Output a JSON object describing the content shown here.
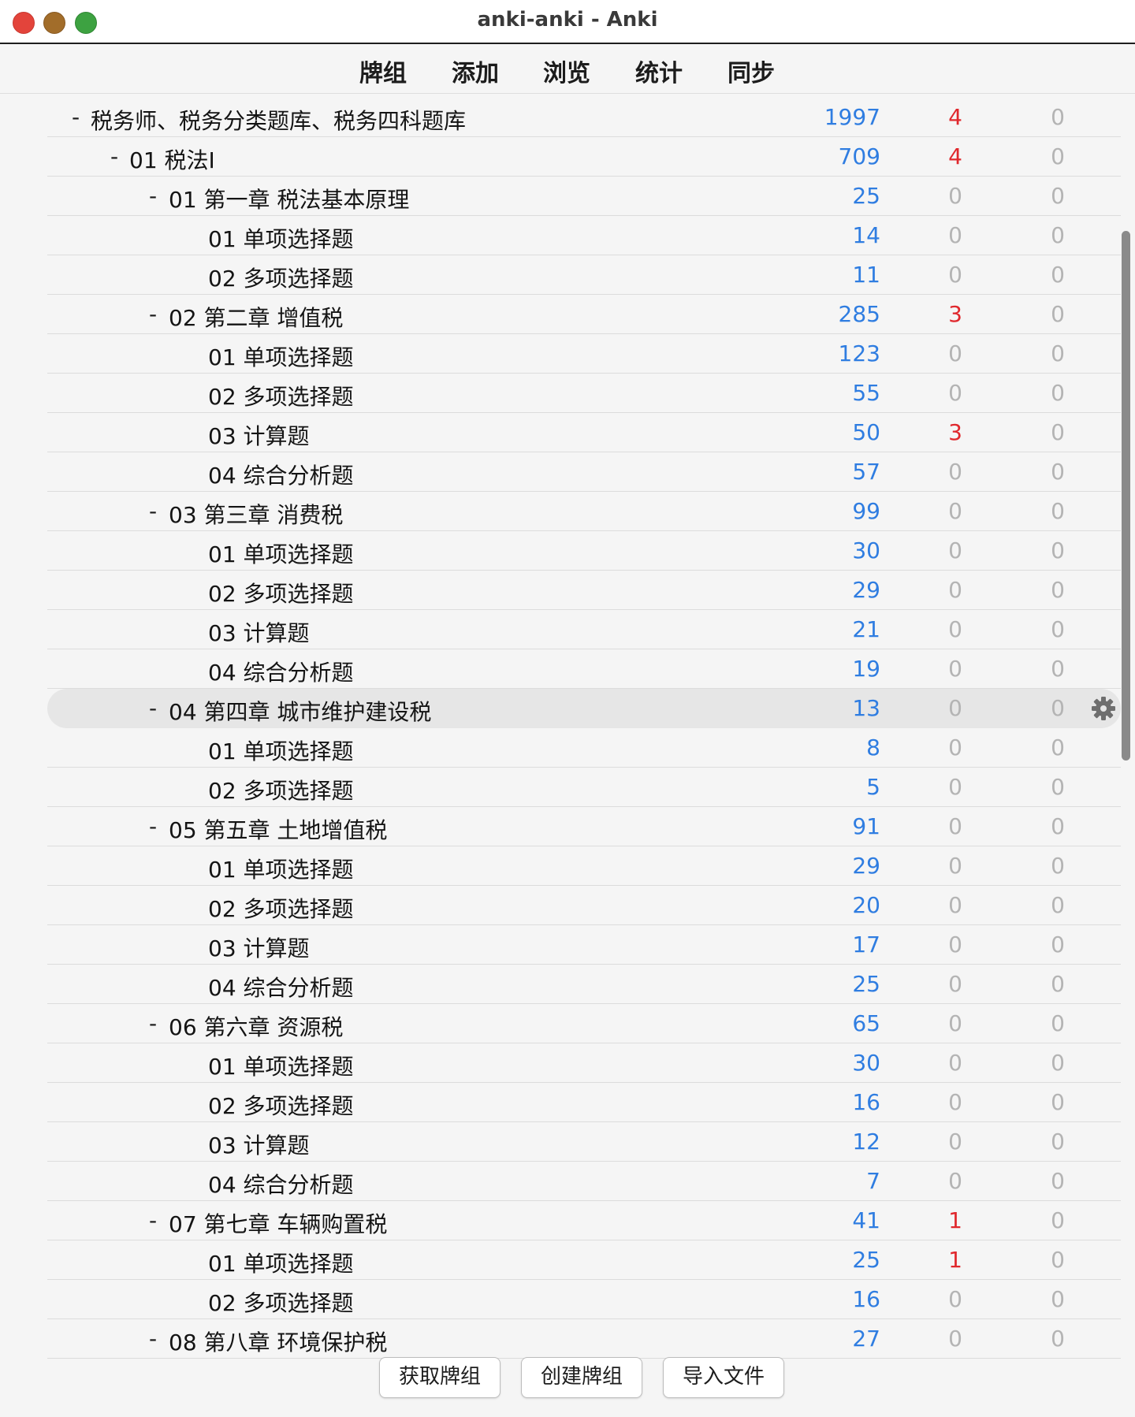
{
  "window": {
    "title": "anki-anki - Anki"
  },
  "toolbar": {
    "items": [
      {
        "label": "牌组"
      },
      {
        "label": "添加"
      },
      {
        "label": "浏览"
      },
      {
        "label": "统计"
      },
      {
        "label": "同步"
      }
    ]
  },
  "decks": [
    {
      "collapse": "-",
      "name": "税务师、税务分类题库、税务四科题库",
      "level": 0,
      "due": "1997",
      "new": "4",
      "learn": "0"
    },
    {
      "collapse": "-",
      "name": "01 税法I",
      "level": 1,
      "due": "709",
      "new": "4",
      "learn": "0"
    },
    {
      "collapse": "-",
      "name": "01 第一章 税法基本原理",
      "level": 2,
      "due": "25",
      "new": "0",
      "learn": "0"
    },
    {
      "collapse": "",
      "name": "01 单项选择题",
      "level": 3,
      "due": "14",
      "new": "0",
      "learn": "0"
    },
    {
      "collapse": "",
      "name": "02 多项选择题",
      "level": 3,
      "due": "11",
      "new": "0",
      "learn": "0"
    },
    {
      "collapse": "-",
      "name": "02 第二章 增值税",
      "level": 2,
      "due": "285",
      "new": "3",
      "learn": "0"
    },
    {
      "collapse": "",
      "name": "01 单项选择题",
      "level": 3,
      "due": "123",
      "new": "0",
      "learn": "0"
    },
    {
      "collapse": "",
      "name": "02 多项选择题",
      "level": 3,
      "due": "55",
      "new": "0",
      "learn": "0"
    },
    {
      "collapse": "",
      "name": "03 计算题",
      "level": 3,
      "due": "50",
      "new": "3",
      "learn": "0"
    },
    {
      "collapse": "",
      "name": "04 综合分析题",
      "level": 3,
      "due": "57",
      "new": "0",
      "learn": "0"
    },
    {
      "collapse": "-",
      "name": "03 第三章 消费税",
      "level": 2,
      "due": "99",
      "new": "0",
      "learn": "0"
    },
    {
      "collapse": "",
      "name": "01 单项选择题",
      "level": 3,
      "due": "30",
      "new": "0",
      "learn": "0"
    },
    {
      "collapse": "",
      "name": "02 多项选择题",
      "level": 3,
      "due": "29",
      "new": "0",
      "learn": "0"
    },
    {
      "collapse": "",
      "name": "03 计算题",
      "level": 3,
      "due": "21",
      "new": "0",
      "learn": "0"
    },
    {
      "collapse": "",
      "name": "04 综合分析题",
      "level": 3,
      "due": "19",
      "new": "0",
      "learn": "0"
    },
    {
      "collapse": "-",
      "name": "04 第四章 城市维护建设税",
      "level": 2,
      "due": "13",
      "new": "0",
      "learn": "0",
      "selected": true
    },
    {
      "collapse": "",
      "name": "01 单项选择题",
      "level": 3,
      "due": "8",
      "new": "0",
      "learn": "0"
    },
    {
      "collapse": "",
      "name": "02 多项选择题",
      "level": 3,
      "due": "5",
      "new": "0",
      "learn": "0"
    },
    {
      "collapse": "-",
      "name": "05 第五章 土地增值税",
      "level": 2,
      "due": "91",
      "new": "0",
      "learn": "0"
    },
    {
      "collapse": "",
      "name": "01 单项选择题",
      "level": 3,
      "due": "29",
      "new": "0",
      "learn": "0"
    },
    {
      "collapse": "",
      "name": "02 多项选择题",
      "level": 3,
      "due": "20",
      "new": "0",
      "learn": "0"
    },
    {
      "collapse": "",
      "name": "03 计算题",
      "level": 3,
      "due": "17",
      "new": "0",
      "learn": "0"
    },
    {
      "collapse": "",
      "name": "04 综合分析题",
      "level": 3,
      "due": "25",
      "new": "0",
      "learn": "0"
    },
    {
      "collapse": "-",
      "name": "06 第六章 资源税",
      "level": 2,
      "due": "65",
      "new": "0",
      "learn": "0"
    },
    {
      "collapse": "",
      "name": "01 单项选择题",
      "level": 3,
      "due": "30",
      "new": "0",
      "learn": "0"
    },
    {
      "collapse": "",
      "name": "02 多项选择题",
      "level": 3,
      "due": "16",
      "new": "0",
      "learn": "0"
    },
    {
      "collapse": "",
      "name": "03 计算题",
      "level": 3,
      "due": "12",
      "new": "0",
      "learn": "0"
    },
    {
      "collapse": "",
      "name": "04 综合分析题",
      "level": 3,
      "due": "7",
      "new": "0",
      "learn": "0"
    },
    {
      "collapse": "-",
      "name": "07 第七章 车辆购置税",
      "level": 2,
      "due": "41",
      "new": "1",
      "learn": "0"
    },
    {
      "collapse": "",
      "name": "01 单项选择题",
      "level": 3,
      "due": "25",
      "new": "1",
      "learn": "0"
    },
    {
      "collapse": "",
      "name": "02 多项选择题",
      "level": 3,
      "due": "16",
      "new": "0",
      "learn": "0"
    },
    {
      "collapse": "-",
      "name": "08 第八章 环境保护税",
      "level": 2,
      "due": "27",
      "new": "0",
      "learn": "0"
    }
  ],
  "buttons": {
    "get_shared": "获取牌组",
    "create_deck": "创建牌组",
    "import_file": "导入文件"
  },
  "colors": {
    "due": "#2f7de1",
    "new_active": "#e0282d",
    "zero": "#b4b4b4"
  },
  "icons": {
    "gear": "gear-icon"
  }
}
